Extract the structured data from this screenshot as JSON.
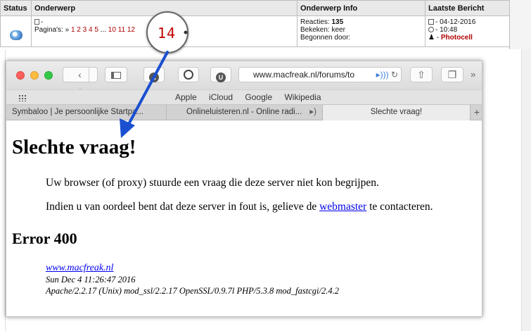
{
  "forum": {
    "headers": {
      "status": "Status",
      "subject": "Onderwerp",
      "info": "Onderwerp Info",
      "last": "Laatste Bericht"
    },
    "row": {
      "subject_line": "-",
      "pages_prefix": "Pagina's: »",
      "pages": [
        "1",
        "2",
        "3",
        "4",
        "5",
        "...",
        "10",
        "11",
        "12"
      ],
      "info": {
        "replies_label": "Reacties:",
        "replies_value": "135",
        "views": "Bekeken: keer",
        "started": "Begonnen door:"
      },
      "last": {
        "date": "- 04-12-2016",
        "time": "- 10:48",
        "user_prefix": "-",
        "user": "Photocell"
      }
    }
  },
  "bubble": {
    "number": "14"
  },
  "browser": {
    "url": "www.macfreak.nl/forums/to",
    "favorites": [
      "Apple",
      "iCloud",
      "Google",
      "Wikipedia"
    ],
    "tabs": [
      "Symbaloo | Je persoonlijke Startpa...",
      "Onlineluisteren.nl - Online radi...",
      "Slechte vraag!"
    ],
    "new_tab_symbol": "+",
    "more_symbol": "»"
  },
  "page": {
    "title": "Slechte vraag!",
    "p1": "Uw browser (of proxy) stuurde een vraag die deze server niet kon begrijpen.",
    "p2_before": "Indien u van oordeel bent dat deze server in fout is, gelieve de",
    "p2_link": "webmaster",
    "p2_after": "te contacteren.",
    "error_heading": "Error 400",
    "address": {
      "link": "www.macfreak.nl",
      "date": "Sun Dec 4 11:26:47 2016",
      "server": "Apache/2.2.17 (Unix) mod_ssl/2.2.17 OpenSSL/0.9.7l PHP/5.3.8 mod_fastcgi/2.4.2"
    }
  },
  "colors": {
    "accent_red": "#c00000",
    "arrow_blue": "#1a4fd0",
    "link_blue": "#0000ee"
  }
}
